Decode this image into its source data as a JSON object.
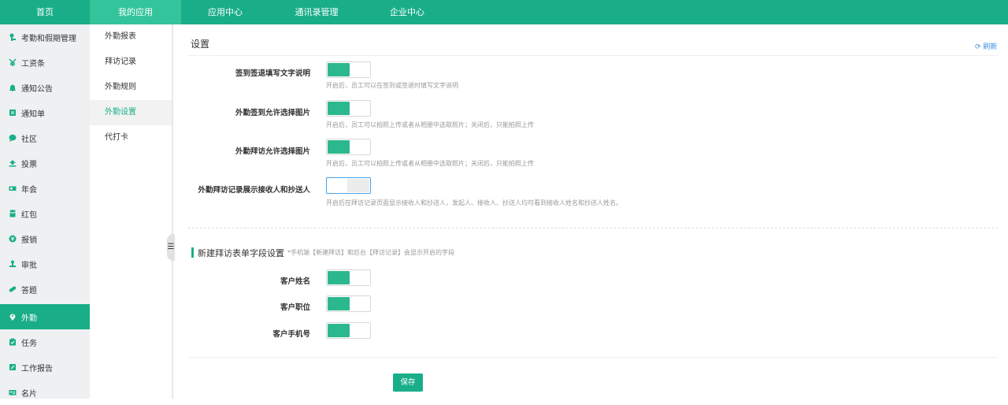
{
  "topnav": {
    "tabs": [
      {
        "label": "首页"
      },
      {
        "label": "我的应用"
      },
      {
        "label": "应用中心"
      },
      {
        "label": "通讯录管理"
      },
      {
        "label": "企业中心"
      }
    ],
    "active_tab": "我的应用"
  },
  "sidebar": {
    "items": [
      {
        "label": "考勤和假期管理",
        "icon": "pin-icon"
      },
      {
        "label": "工资条",
        "icon": "yen-icon"
      },
      {
        "label": "通知公告",
        "icon": "bell-icon"
      },
      {
        "label": "通知单",
        "icon": "notice-icon"
      },
      {
        "label": "社区",
        "icon": "chat-icon"
      },
      {
        "label": "投票",
        "icon": "vote-icon"
      },
      {
        "label": "年会",
        "icon": "ticket-icon"
      },
      {
        "label": "红包",
        "icon": "redpacket-icon"
      },
      {
        "label": "报销",
        "icon": "coin-icon"
      },
      {
        "label": "审批",
        "icon": "stamp-icon"
      },
      {
        "label": "答题",
        "icon": "link-icon"
      },
      {
        "label": "外勤",
        "icon": "location-icon"
      },
      {
        "label": "任务",
        "icon": "task-icon"
      },
      {
        "label": "工作报告",
        "icon": "report-icon"
      },
      {
        "label": "名片",
        "icon": "card-icon"
      }
    ],
    "active_item": "外勤"
  },
  "subnav": {
    "items": [
      {
        "label": "外勤报表"
      },
      {
        "label": "拜访记录"
      },
      {
        "label": "外勤规则"
      },
      {
        "label": "外勤设置"
      },
      {
        "label": "代打卡"
      }
    ],
    "active_item": "外勤设置"
  },
  "settings": {
    "title": "设置",
    "refresh_label": "刷新",
    "options": [
      {
        "label": "签到签退填写文字说明",
        "enabled": true,
        "hint": "开启后，员工可以在签到或签退时填写文字说明"
      },
      {
        "label": "外勤签到允许选择图片",
        "enabled": true,
        "hint": "开启后，员工可以拍照上传或者从相册中选取照片；关闭后，只能拍照上传"
      },
      {
        "label": "外勤拜访允许选择图片",
        "enabled": true,
        "hint": "开启后，员工可以拍照上传或者从相册中选取照片；关闭后，只能拍照上传"
      },
      {
        "label": "外勤拜访记录展示接收人和抄送人",
        "enabled": false,
        "hint": "开启后在拜访记录页面显示接收人和抄送人，发起人、接收人、抄送人均可看到接收人姓名和抄送人姓名。"
      }
    ]
  },
  "visit_form": {
    "title": "新建拜访表单字段设置",
    "note": "*手机端【新建拜访】和后台【拜访记录】会显示开启的字段",
    "fields": [
      {
        "label": "客户姓名",
        "enabled": true
      },
      {
        "label": "客户职位",
        "enabled": true
      },
      {
        "label": "客户手机号",
        "enabled": true
      }
    ]
  },
  "save_label": "保存",
  "colors": {
    "primary": "#1aae88",
    "toggle_on": "#2cb88e",
    "link": "#3b8de0"
  }
}
